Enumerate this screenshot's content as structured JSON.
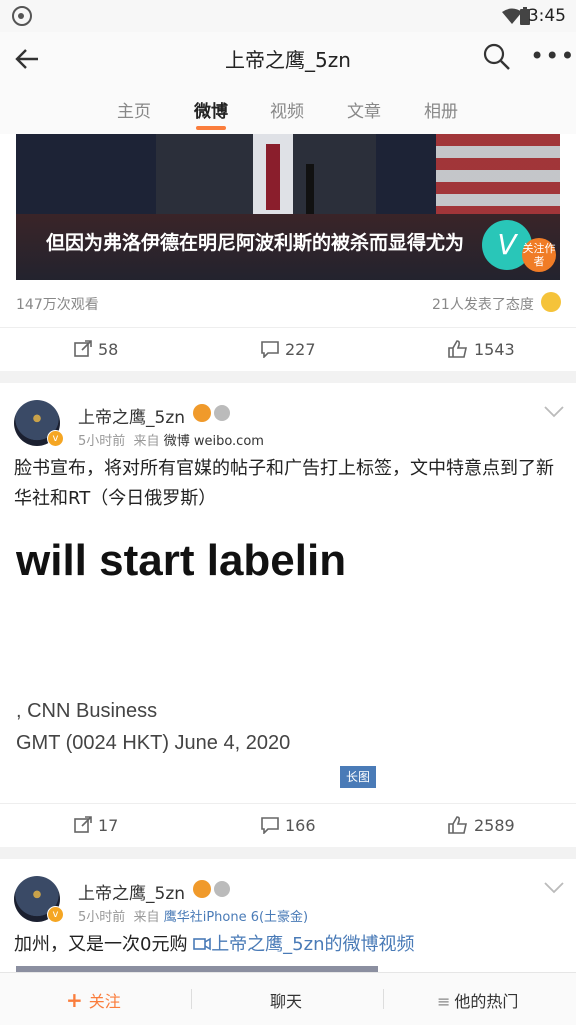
{
  "status_bar": {
    "time": "3:45"
  },
  "header": {
    "title": "上帝之鹰_5zn"
  },
  "tabs": [
    {
      "label": "主页"
    },
    {
      "label": "微博"
    },
    {
      "label": "视频"
    },
    {
      "label": "文章"
    },
    {
      "label": "相册"
    }
  ],
  "active_tab": "微博",
  "posts": [
    {
      "video_caption": "但因为弗洛伊德在明尼阿波利斯的被杀而显得尤为",
      "follow_badge": "关注作者",
      "views": "147万次观看",
      "reactions": "21人发表了态度",
      "actions": {
        "repost": "58",
        "comment": "227",
        "like": "1543"
      }
    },
    {
      "author": "上帝之鹰_5zn",
      "time": "5小时前",
      "source_prefix": "来自",
      "source": "微博 weibo.com",
      "text": "脸书宣布，将对所有官媒的帖子和广告打上标签，文中特意点到了新华社和RT（今日俄罗斯）",
      "image_text_1": "will start labelin",
      "image_text_2": ", CNN Business",
      "image_text_3": "GMT (0024 HKT) June 4, 2020",
      "image_tag": "长图",
      "actions": {
        "repost": "17",
        "comment": "166",
        "like": "2589"
      }
    },
    {
      "author": "上帝之鹰_5zn",
      "time": "5小时前",
      "source_prefix": "来自",
      "source": "鹰华社iPhone 6(土豪金)",
      "text": "加州，又是一次0元购",
      "link_text": "上帝之鹰_5zn的微博视频"
    }
  ],
  "bottom_bar": {
    "follow": "关注",
    "chat": "聊天",
    "hot": "他的热门"
  },
  "colors": {
    "accent": "#fa7d3c",
    "link": "#4a7bb7"
  }
}
